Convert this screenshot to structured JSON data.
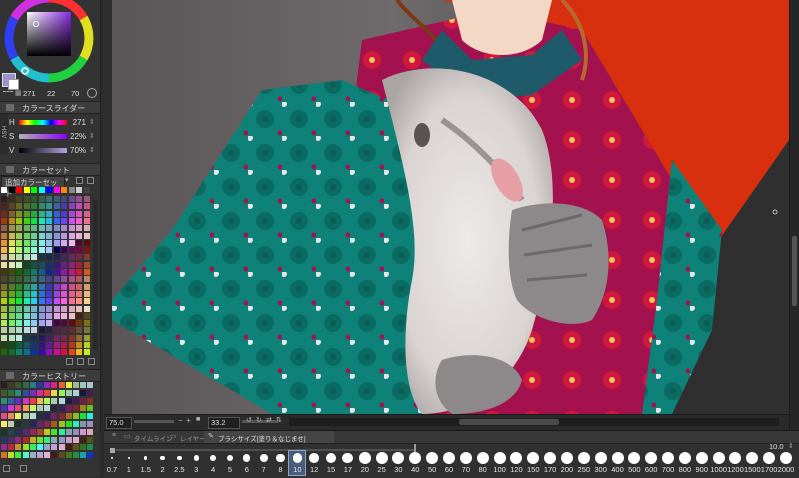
{
  "color_wheel": {
    "readout_hue": "271",
    "readout_sat": "22",
    "readout_val": "70"
  },
  "color_slider": {
    "title": "カラースライダー",
    "h": {
      "label": "H",
      "value": "271"
    },
    "s": {
      "label": "S",
      "value": "22%"
    },
    "v": {
      "label": "V",
      "value": "70%"
    },
    "mode_tab": "HSV"
  },
  "color_set": {
    "title": "カラーセット",
    "selector": "追加カラーセット"
  },
  "color_history": {
    "title": "カラーヒストリー"
  },
  "status": {
    "zoom": "75.0",
    "rotation": "33.2"
  },
  "brush_panel": {
    "tab_timeline": "タイムライン",
    "tab_layer": "レイヤー",
    "tab_brushsize": "ブラシサイズ[塗り＆なじませ]",
    "size_value": "10.0",
    "selected_size": "10",
    "sizes": [
      "0.7",
      "1",
      "1.5",
      "2",
      "2.5",
      "3",
      "4",
      "5",
      "6",
      "7",
      "8",
      "10",
      "12",
      "15",
      "17",
      "20",
      "25",
      "30",
      "40",
      "50",
      "60",
      "70",
      "80",
      "100",
      "120",
      "150",
      "170",
      "200",
      "250",
      "300",
      "400",
      "500",
      "600",
      "700",
      "800",
      "900",
      "1000",
      "1200",
      "1500",
      "1700",
      "2000"
    ]
  },
  "colors": {
    "accent": "#9b8fd0",
    "panel_bg": "#333333",
    "canvas_orange": "#d8300e",
    "teal": "#0e8278",
    "magenta": "#a3124e"
  }
}
